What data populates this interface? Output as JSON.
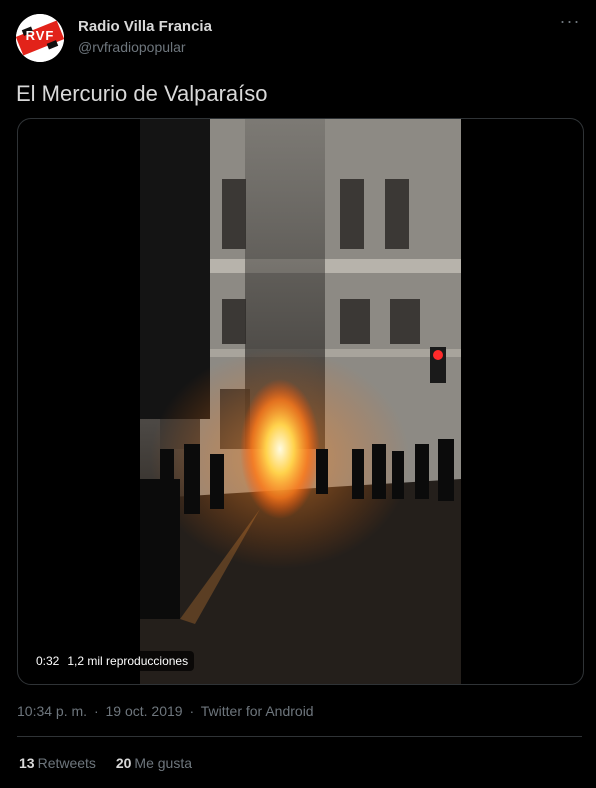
{
  "author": {
    "display_name": "Radio Villa Francia",
    "handle": "@rvfradiopopular",
    "avatar_text": "RVF"
  },
  "tweet": {
    "text": "El Mercurio de Valparaíso"
  },
  "media": {
    "duration": "0:32",
    "views": "1,2 mil reproducciones"
  },
  "meta": {
    "time": "10:34 p. m.",
    "separator": "·",
    "date": "19 oct. 2019",
    "separator2": "·",
    "source": "Twitter for Android"
  },
  "stats": {
    "retweets_count": "13",
    "retweets_label": "Retweets",
    "likes_count": "20",
    "likes_label": "Me gusta"
  },
  "icons": {
    "more": "more-icon"
  },
  "colors": {
    "background": "#000000",
    "text": "#d9d9d9",
    "secondary": "#6e767d",
    "border": "#2f3336",
    "brand_red": "#e2231a"
  }
}
